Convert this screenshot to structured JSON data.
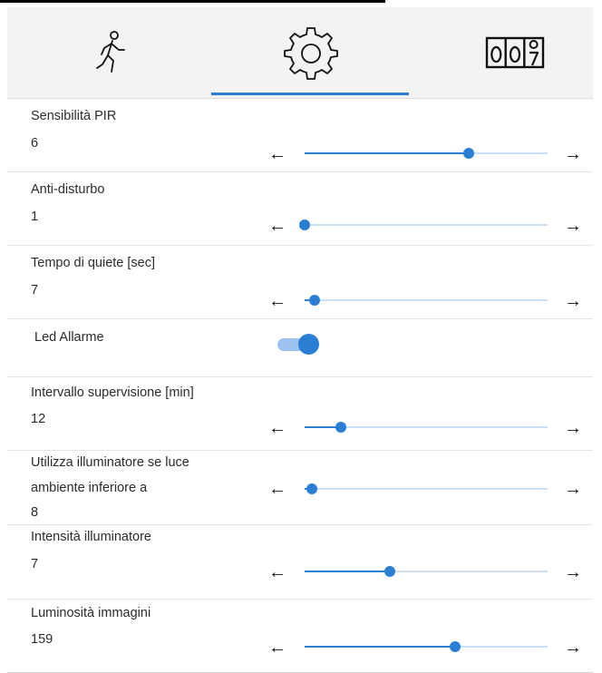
{
  "tabs": [
    {
      "name": "motion",
      "icon": "walking-person-icon"
    },
    {
      "name": "settings",
      "icon": "gear-icon",
      "active": true
    },
    {
      "name": "counter",
      "icon": "counter-icon",
      "text": "007"
    }
  ],
  "colors": {
    "accent": "#2a7fd4",
    "track": "#c9dff6",
    "toggle_track": "#9dc1f0",
    "tabbar_bg": "#f3f3f3"
  },
  "arrows": {
    "left": "←",
    "right": "→"
  },
  "settings": {
    "pir": {
      "label": "Sensibilità PIR",
      "value": "6",
      "level": 0.675
    },
    "antidisturb": {
      "label": "Anti-disturbo",
      "value": "1",
      "level": 0.0
    },
    "quiet": {
      "label": "Tempo di quiete [sec]",
      "value": "7",
      "level": 0.04
    },
    "led": {
      "label": "Led Allarme",
      "on": true
    },
    "supervision": {
      "label": "Intervallo supervisione [min]",
      "value": "12",
      "level": 0.15
    },
    "illuminator_threshold": {
      "label_line1": "Utilizza illuminatore se luce",
      "label_line2": "ambiente inferiore a",
      "value": "8",
      "level": 0.03
    },
    "illuminator_intensity": {
      "label": "Intensità illuminatore",
      "value": "7",
      "level": 0.35
    },
    "brightness": {
      "label": "Luminosità immagini",
      "value": "159",
      "level": 0.62
    }
  }
}
